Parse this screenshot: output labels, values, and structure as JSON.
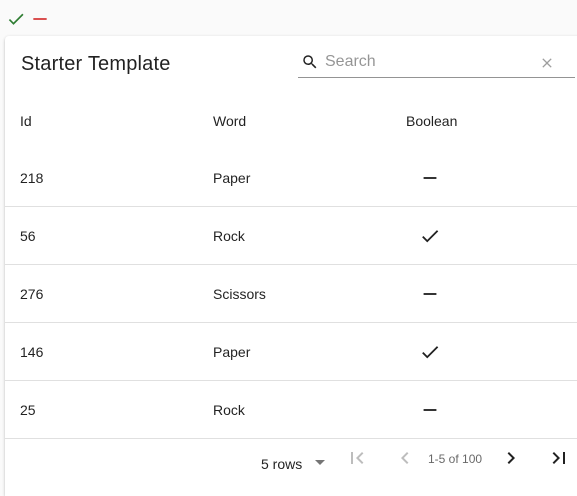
{
  "toolbar": {
    "check_icon": "check-icon",
    "minus_icon": "minus-icon",
    "check_color": "#2e7d32",
    "minus_color": "#d32f2f"
  },
  "table": {
    "title": "Starter Template",
    "search_placeholder": "Search",
    "search_value": "",
    "columns": [
      "Id",
      "Word",
      "Boolean"
    ],
    "rows": [
      {
        "id": "218",
        "word": "Paper",
        "boolean": false
      },
      {
        "id": "56",
        "word": "Rock",
        "boolean": true
      },
      {
        "id": "276",
        "word": "Scissors",
        "boolean": false
      },
      {
        "id": "146",
        "word": "Paper",
        "boolean": true
      },
      {
        "id": "25",
        "word": "Rock",
        "boolean": false
      }
    ]
  },
  "pagination": {
    "rows_label": "5 rows",
    "range_label": "1-5 of 100"
  }
}
